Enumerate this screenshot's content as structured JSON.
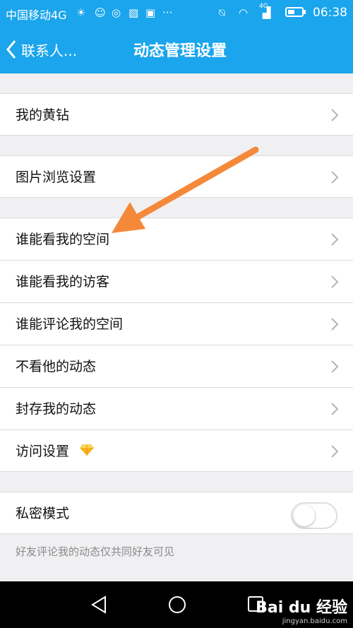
{
  "status_bar": {
    "carrier": "中国移动4G",
    "network_label": "4G",
    "time": "06:38",
    "icons": [
      "sun-icon",
      "face-icon",
      "signal-app-icon",
      "image-icon",
      "app-icon",
      "more-dots-icon",
      "mute-icon",
      "wifi-icon",
      "cellular-signal-icon",
      "battery-icon"
    ]
  },
  "header": {
    "back_label": "联系人...",
    "title": "动态管理设置",
    "color": "#1aa5ec"
  },
  "settings": {
    "group1": {
      "items": [
        {
          "label": "我的黄钻"
        }
      ]
    },
    "group2": {
      "items": [
        {
          "label": "图片浏览设置"
        }
      ]
    },
    "group3": {
      "items": [
        {
          "label": "谁能看我的空间"
        },
        {
          "label": "谁能看我的访客"
        },
        {
          "label": "谁能评论我的空间"
        },
        {
          "label": "不看他的动态"
        },
        {
          "label": "封存我的动态"
        },
        {
          "label": "访问设置"
        }
      ]
    },
    "group4": {
      "items": [
        {
          "label": "私密模式",
          "toggle_on": false
        }
      ],
      "note": "好友评论我的动态仅共同好友可见"
    }
  },
  "annotation_arrow_color": "#f5893a",
  "watermark": {
    "brand": "Bai du 经验",
    "url": "jingyan.baidu.com"
  }
}
